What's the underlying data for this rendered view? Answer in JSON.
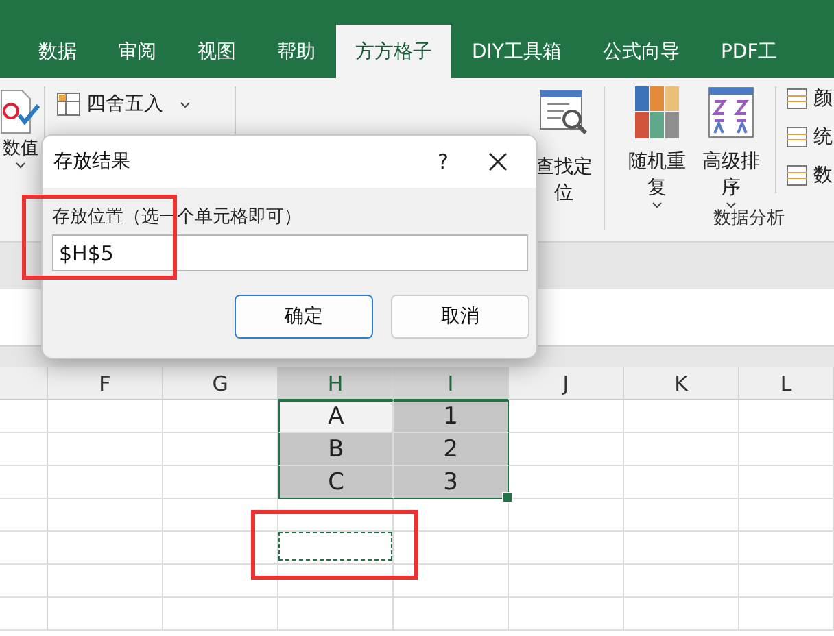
{
  "tabs": [
    {
      "label": "数据",
      "selected": false
    },
    {
      "label": "审阅",
      "selected": false
    },
    {
      "label": "视图",
      "selected": false
    },
    {
      "label": "帮助",
      "selected": false
    },
    {
      "label": "方方格子",
      "selected": true
    },
    {
      "label": "DIY工具箱",
      "selected": false
    },
    {
      "label": "公式向导",
      "selected": false
    },
    {
      "label": "PDF工",
      "selected": false
    }
  ],
  "ribbon": {
    "value_button": {
      "label": "数值"
    },
    "round_item": {
      "label": "四舍五入"
    },
    "find_button": {
      "label": "查找定位"
    },
    "random_button": {
      "label": "随机重复"
    },
    "sort_button": {
      "label": "高级排序"
    },
    "side_items": [
      {
        "label": "颜"
      },
      {
        "label": "统"
      },
      {
        "label": "数"
      }
    ],
    "group_label": "数据分析"
  },
  "dialog": {
    "title": "存放结果",
    "help": "?",
    "field_label": "存放位置（选一个单元格即可）",
    "field_value": "$H$5",
    "buttons": [
      {
        "label": "确定",
        "default": true
      },
      {
        "label": "取消",
        "default": false
      }
    ]
  },
  "sheet": {
    "columns": [
      {
        "label": "F",
        "selected": false
      },
      {
        "label": "G",
        "selected": false
      },
      {
        "label": "H",
        "selected": true
      },
      {
        "label": "I",
        "selected": true
      },
      {
        "label": "J",
        "selected": false
      },
      {
        "label": "K",
        "selected": false
      },
      {
        "label": "L",
        "selected": false
      }
    ],
    "rows": [
      {
        "cells": [
          {
            "selected": false,
            "active": false,
            "marquee": false
          },
          {
            "selected": false,
            "active": false,
            "marquee": false
          },
          {
            "text": "A",
            "selected": false,
            "active": true,
            "marquee": false
          },
          {
            "text": "1",
            "selected": true,
            "active": false,
            "marquee": false
          },
          {
            "selected": false,
            "active": false,
            "marquee": false
          },
          {
            "selected": false,
            "active": false,
            "marquee": false
          },
          {
            "selected": false,
            "active": false,
            "marquee": false
          }
        ]
      },
      {
        "cells": [
          {
            "selected": false,
            "active": false,
            "marquee": false
          },
          {
            "selected": false,
            "active": false,
            "marquee": false
          },
          {
            "text": "B",
            "selected": true,
            "active": false,
            "marquee": false
          },
          {
            "text": "2",
            "selected": true,
            "active": false,
            "marquee": false
          },
          {
            "selected": false,
            "active": false,
            "marquee": false
          },
          {
            "selected": false,
            "active": false,
            "marquee": false
          },
          {
            "selected": false,
            "active": false,
            "marquee": false
          }
        ]
      },
      {
        "cells": [
          {
            "selected": false,
            "active": false,
            "marquee": false
          },
          {
            "selected": false,
            "active": false,
            "marquee": false
          },
          {
            "text": "C",
            "selected": true,
            "active": false,
            "marquee": false
          },
          {
            "text": "3",
            "selected": true,
            "active": false,
            "marquee": false
          },
          {
            "selected": false,
            "active": false,
            "marquee": false
          },
          {
            "selected": false,
            "active": false,
            "marquee": false
          },
          {
            "selected": false,
            "active": false,
            "marquee": false
          }
        ]
      },
      {
        "cells": [
          {
            "selected": false,
            "active": false,
            "marquee": false
          },
          {
            "selected": false,
            "active": false,
            "marquee": false
          },
          {
            "selected": false,
            "active": false,
            "marquee": false
          },
          {
            "selected": false,
            "active": false,
            "marquee": false
          },
          {
            "selected": false,
            "active": false,
            "marquee": false
          },
          {
            "selected": false,
            "active": false,
            "marquee": false
          },
          {
            "selected": false,
            "active": false,
            "marquee": false
          }
        ]
      },
      {
        "cells": [
          {
            "selected": false,
            "active": false,
            "marquee": false
          },
          {
            "selected": false,
            "active": false,
            "marquee": false
          },
          {
            "selected": false,
            "active": false,
            "marquee": true
          },
          {
            "selected": false,
            "active": false,
            "marquee": false
          },
          {
            "selected": false,
            "active": false,
            "marquee": false
          },
          {
            "selected": false,
            "active": false,
            "marquee": false
          },
          {
            "selected": false,
            "active": false,
            "marquee": false
          }
        ]
      },
      {
        "cells": [
          {
            "selected": false,
            "active": false,
            "marquee": false
          },
          {
            "selected": false,
            "active": false,
            "marquee": false
          },
          {
            "selected": false,
            "active": false,
            "marquee": false
          },
          {
            "selected": false,
            "active": false,
            "marquee": false
          },
          {
            "selected": false,
            "active": false,
            "marquee": false
          },
          {
            "selected": false,
            "active": false,
            "marquee": false
          },
          {
            "selected": false,
            "active": false,
            "marquee": false
          }
        ]
      },
      {
        "cells": [
          {
            "selected": false,
            "active": false,
            "marquee": false
          },
          {
            "selected": false,
            "active": false,
            "marquee": false
          },
          {
            "selected": false,
            "active": false,
            "marquee": false
          },
          {
            "selected": false,
            "active": false,
            "marquee": false
          },
          {
            "selected": false,
            "active": false,
            "marquee": false
          },
          {
            "selected": false,
            "active": false,
            "marquee": false
          },
          {
            "selected": false,
            "active": false,
            "marquee": false
          }
        ]
      }
    ]
  }
}
